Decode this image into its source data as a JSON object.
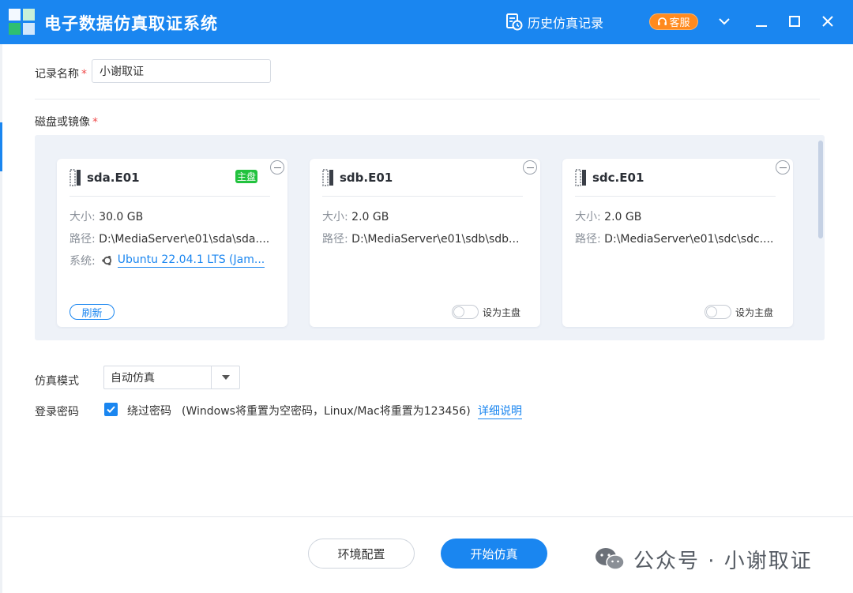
{
  "app": {
    "title": "电子数据仿真取证系统"
  },
  "header": {
    "history_label": "历史仿真记录",
    "service_label": "客服"
  },
  "form": {
    "record_name_label": "记录名称",
    "record_name_value": "小谢取证",
    "disk_label": "磁盘或镜像",
    "required_mark": "*"
  },
  "disks": [
    {
      "name": "sda.E01",
      "badge": "主盘",
      "size_key": "大小:",
      "size": "30.0 GB",
      "path_key": "路径:",
      "path": "D:\\MediaServer\\e01\\sda\\sda....",
      "system_key": "系统:",
      "system": "Ubuntu 22.04.1 LTS (Jam...",
      "refresh_label": "刷新"
    },
    {
      "name": "sdb.E01",
      "size_key": "大小:",
      "size": "2.0 GB",
      "path_key": "路径:",
      "path": "D:\\MediaServer\\e01\\sdb\\sdb...",
      "toggle_label": "设为主盘"
    },
    {
      "name": "sdc.E01",
      "size_key": "大小:",
      "size": "2.0 GB",
      "path_key": "路径:",
      "path": "D:\\MediaServer\\e01\\sdc\\sdc....",
      "toggle_label": "设为主盘"
    }
  ],
  "mode": {
    "label": "仿真模式",
    "selected": "自动仿真"
  },
  "password": {
    "label": "登录密码",
    "checkbox_label": "绕过密码",
    "checked": true,
    "note": "(Windows将重置为空密码，Linux/Mac将重置为123456)",
    "detail_link": "详细说明"
  },
  "footer": {
    "env_button": "环境配置",
    "start_button": "开始仿真"
  },
  "watermark": {
    "text": "公众号 · 小谢取证"
  },
  "colors": {
    "primary": "#1a86f0",
    "service": "#ff8a1e",
    "badge": "#22c23e",
    "required": "#f04b4b"
  }
}
